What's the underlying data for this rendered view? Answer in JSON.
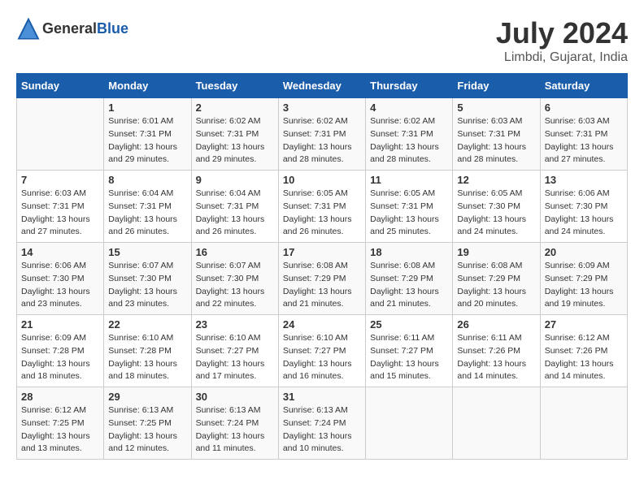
{
  "header": {
    "logo_general": "General",
    "logo_blue": "Blue",
    "title": "July 2024",
    "location": "Limbdi, Gujarat, India"
  },
  "days_of_week": [
    "Sunday",
    "Monday",
    "Tuesday",
    "Wednesday",
    "Thursday",
    "Friday",
    "Saturday"
  ],
  "weeks": [
    [
      {
        "day": "",
        "sunrise": "",
        "sunset": "",
        "daylight": ""
      },
      {
        "day": "1",
        "sunrise": "6:01 AM",
        "sunset": "7:31 PM",
        "daylight": "13 hours and 29 minutes."
      },
      {
        "day": "2",
        "sunrise": "6:02 AM",
        "sunset": "7:31 PM",
        "daylight": "13 hours and 29 minutes."
      },
      {
        "day": "3",
        "sunrise": "6:02 AM",
        "sunset": "7:31 PM",
        "daylight": "13 hours and 28 minutes."
      },
      {
        "day": "4",
        "sunrise": "6:02 AM",
        "sunset": "7:31 PM",
        "daylight": "13 hours and 28 minutes."
      },
      {
        "day": "5",
        "sunrise": "6:03 AM",
        "sunset": "7:31 PM",
        "daylight": "13 hours and 28 minutes."
      },
      {
        "day": "6",
        "sunrise": "6:03 AM",
        "sunset": "7:31 PM",
        "daylight": "13 hours and 27 minutes."
      }
    ],
    [
      {
        "day": "7",
        "sunrise": "6:03 AM",
        "sunset": "7:31 PM",
        "daylight": "13 hours and 27 minutes."
      },
      {
        "day": "8",
        "sunrise": "6:04 AM",
        "sunset": "7:31 PM",
        "daylight": "13 hours and 26 minutes."
      },
      {
        "day": "9",
        "sunrise": "6:04 AM",
        "sunset": "7:31 PM",
        "daylight": "13 hours and 26 minutes."
      },
      {
        "day": "10",
        "sunrise": "6:05 AM",
        "sunset": "7:31 PM",
        "daylight": "13 hours and 26 minutes."
      },
      {
        "day": "11",
        "sunrise": "6:05 AM",
        "sunset": "7:31 PM",
        "daylight": "13 hours and 25 minutes."
      },
      {
        "day": "12",
        "sunrise": "6:05 AM",
        "sunset": "7:30 PM",
        "daylight": "13 hours and 24 minutes."
      },
      {
        "day": "13",
        "sunrise": "6:06 AM",
        "sunset": "7:30 PM",
        "daylight": "13 hours and 24 minutes."
      }
    ],
    [
      {
        "day": "14",
        "sunrise": "6:06 AM",
        "sunset": "7:30 PM",
        "daylight": "13 hours and 23 minutes."
      },
      {
        "day": "15",
        "sunrise": "6:07 AM",
        "sunset": "7:30 PM",
        "daylight": "13 hours and 23 minutes."
      },
      {
        "day": "16",
        "sunrise": "6:07 AM",
        "sunset": "7:30 PM",
        "daylight": "13 hours and 22 minutes."
      },
      {
        "day": "17",
        "sunrise": "6:08 AM",
        "sunset": "7:29 PM",
        "daylight": "13 hours and 21 minutes."
      },
      {
        "day": "18",
        "sunrise": "6:08 AM",
        "sunset": "7:29 PM",
        "daylight": "13 hours and 21 minutes."
      },
      {
        "day": "19",
        "sunrise": "6:08 AM",
        "sunset": "7:29 PM",
        "daylight": "13 hours and 20 minutes."
      },
      {
        "day": "20",
        "sunrise": "6:09 AM",
        "sunset": "7:29 PM",
        "daylight": "13 hours and 19 minutes."
      }
    ],
    [
      {
        "day": "21",
        "sunrise": "6:09 AM",
        "sunset": "7:28 PM",
        "daylight": "13 hours and 18 minutes."
      },
      {
        "day": "22",
        "sunrise": "6:10 AM",
        "sunset": "7:28 PM",
        "daylight": "13 hours and 18 minutes."
      },
      {
        "day": "23",
        "sunrise": "6:10 AM",
        "sunset": "7:27 PM",
        "daylight": "13 hours and 17 minutes."
      },
      {
        "day": "24",
        "sunrise": "6:10 AM",
        "sunset": "7:27 PM",
        "daylight": "13 hours and 16 minutes."
      },
      {
        "day": "25",
        "sunrise": "6:11 AM",
        "sunset": "7:27 PM",
        "daylight": "13 hours and 15 minutes."
      },
      {
        "day": "26",
        "sunrise": "6:11 AM",
        "sunset": "7:26 PM",
        "daylight": "13 hours and 14 minutes."
      },
      {
        "day": "27",
        "sunrise": "6:12 AM",
        "sunset": "7:26 PM",
        "daylight": "13 hours and 14 minutes."
      }
    ],
    [
      {
        "day": "28",
        "sunrise": "6:12 AM",
        "sunset": "7:25 PM",
        "daylight": "13 hours and 13 minutes."
      },
      {
        "day": "29",
        "sunrise": "6:13 AM",
        "sunset": "7:25 PM",
        "daylight": "13 hours and 12 minutes."
      },
      {
        "day": "30",
        "sunrise": "6:13 AM",
        "sunset": "7:24 PM",
        "daylight": "13 hours and 11 minutes."
      },
      {
        "day": "31",
        "sunrise": "6:13 AM",
        "sunset": "7:24 PM",
        "daylight": "13 hours and 10 minutes."
      },
      {
        "day": "",
        "sunrise": "",
        "sunset": "",
        "daylight": ""
      },
      {
        "day": "",
        "sunrise": "",
        "sunset": "",
        "daylight": ""
      },
      {
        "day": "",
        "sunrise": "",
        "sunset": "",
        "daylight": ""
      }
    ]
  ]
}
